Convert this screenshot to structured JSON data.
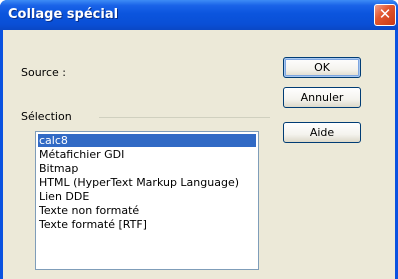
{
  "window": {
    "title": "Collage spécial",
    "close_glyph": "✕"
  },
  "source": {
    "label": "Source :"
  },
  "selection": {
    "label": "Sélection",
    "items": [
      "calc8",
      "Métafichier GDI",
      "Bitmap",
      "HTML (HyperText Markup Language)",
      "Lien DDE",
      "Texte non formaté",
      "Texte formaté [RTF]"
    ],
    "selected_value": "calc8"
  },
  "buttons": {
    "ok": "OK",
    "annuler": "Annuler",
    "aide": "Aide"
  },
  "colors": {
    "titlebar": "#0a52e0",
    "selection_highlight": "#316ac5",
    "dialog_face": "#ece9d8",
    "close_button": "#e2572f"
  }
}
